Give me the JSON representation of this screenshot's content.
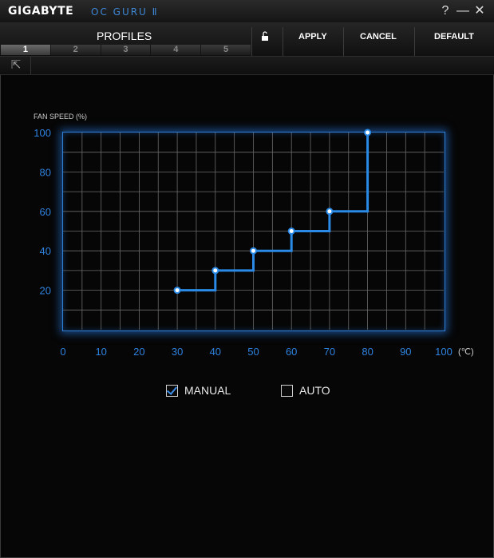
{
  "window": {
    "brand": "GIGABYTE",
    "product": "OC GURU Ⅱ",
    "help_label": "?",
    "minimize_label": "—",
    "close_label": "✕"
  },
  "toolbar": {
    "profiles_label": "PROFILES",
    "tabs": [
      "1",
      "2",
      "3",
      "4",
      "5"
    ],
    "active_tab": "1",
    "apply_label": "APPLY",
    "cancel_label": "CANCEL",
    "default_label": "DEFAULT"
  },
  "subbar": {
    "back_icon": "⇱"
  },
  "chart_data": {
    "type": "line",
    "ylabel": "FAN SPEED (%)",
    "x_unit": "(℃)",
    "xlim": [
      0,
      100
    ],
    "ylim": [
      0,
      100
    ],
    "x_ticks": [
      0,
      10,
      20,
      30,
      40,
      50,
      60,
      70,
      80,
      90,
      100
    ],
    "y_ticks": [
      20,
      40,
      60,
      80,
      100
    ],
    "grid": true,
    "step": true,
    "series": [
      {
        "x": [
          30,
          40,
          50,
          60,
          70,
          80
        ],
        "y": [
          20,
          30,
          40,
          50,
          60,
          100
        ]
      }
    ],
    "line_color": "#2a8ae6"
  },
  "mode": {
    "manual_label": "MANUAL",
    "manual_checked": true,
    "auto_label": "AUTO",
    "auto_checked": false
  }
}
